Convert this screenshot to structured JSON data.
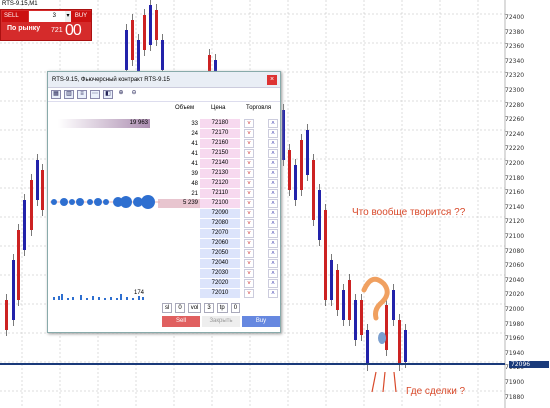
{
  "chart": {
    "symbol": "RTS-9.15,M1",
    "price_labels": [
      "72400",
      "72380",
      "72360",
      "72340",
      "72320",
      "72300",
      "72280",
      "72260",
      "72240",
      "72220",
      "72200",
      "72180",
      "72160",
      "72140",
      "72120",
      "72100",
      "72080",
      "72060",
      "72040",
      "72020",
      "72000",
      "71980",
      "71960",
      "71940",
      "71920",
      "71900",
      "71880"
    ],
    "current_price": "72096",
    "annotation_1": "Что вообще творится ??",
    "annotation_2": "Где сделки ?"
  },
  "one_click": {
    "sell_label": "SELL",
    "lot": "3",
    "buy_label": "BUY",
    "market_label": "По рынку",
    "price_small": "721",
    "price_big": "00"
  },
  "dom": {
    "title": "RTS-9.15, Фьючерсный контракт RTS-9.15",
    "col_volume": "Объем",
    "col_price": "Цена",
    "col_trade": "Торговля",
    "big_volume": "19 963",
    "level_volume": "5 239",
    "small_volume": "174",
    "asks": [
      {
        "vol": "33",
        "price": "72180"
      },
      {
        "vol": "24",
        "price": "72170"
      },
      {
        "vol": "41",
        "price": "72160"
      },
      {
        "vol": "41",
        "price": "72150"
      },
      {
        "vol": "41",
        "price": "72140"
      },
      {
        "vol": "39",
        "price": "72130"
      },
      {
        "vol": "48",
        "price": "72120"
      },
      {
        "vol": "21",
        "price": "72110"
      },
      {
        "vol": "",
        "price": "72100"
      }
    ],
    "bids": [
      {
        "vol": "",
        "price": "72090"
      },
      {
        "vol": "",
        "price": "72080"
      },
      {
        "vol": "",
        "price": "72070"
      },
      {
        "vol": "",
        "price": "72060"
      },
      {
        "vol": "",
        "price": "72050"
      },
      {
        "vol": "",
        "price": "72040"
      },
      {
        "vol": "",
        "price": "72030"
      },
      {
        "vol": "",
        "price": "72020"
      },
      {
        "vol": "",
        "price": "72010"
      }
    ],
    "sl_value": "0",
    "vol_value": "3",
    "tp_value": "0",
    "sl_label": "sl",
    "vol_label": "vol",
    "tp_label": "tp",
    "sell_btn": "Sell",
    "close_btn": "Закрыть",
    "buy_btn": "Buy"
  }
}
